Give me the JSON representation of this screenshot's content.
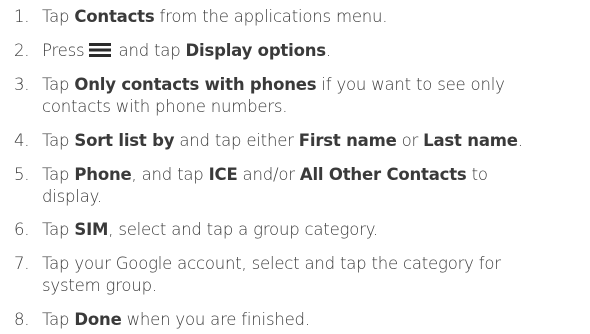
{
  "steps": [
    {
      "number": "1.",
      "parts": [
        {
          "t": "Tap "
        },
        {
          "t": "Contacts",
          "b": true
        },
        {
          "t": " from the applications menu."
        }
      ]
    },
    {
      "number": "2.",
      "parts": [
        {
          "t": "Press "
        },
        {
          "icon": "menu-icon"
        },
        {
          "t": " and tap "
        },
        {
          "t": "Display options",
          "b": true
        },
        {
          "t": "."
        }
      ]
    },
    {
      "number": "3.",
      "parts": [
        {
          "t": "Tap "
        },
        {
          "t": "Only contacts with phones",
          "b": true
        },
        {
          "t": " if you want to see only"
        },
        {
          "br": true
        },
        {
          "t": "contacts with phone numbers."
        }
      ]
    },
    {
      "number": "4.",
      "parts": [
        {
          "t": "Tap "
        },
        {
          "t": "Sort list by",
          "b": true
        },
        {
          "t": " and tap either "
        },
        {
          "t": "First name",
          "b": true
        },
        {
          "t": " or "
        },
        {
          "t": "Last name",
          "b": true
        },
        {
          "t": "."
        }
      ]
    },
    {
      "number": "5.",
      "parts": [
        {
          "t": "Tap "
        },
        {
          "t": "Phone",
          "b": true
        },
        {
          "t": ", and tap "
        },
        {
          "t": "ICE",
          "b": true
        },
        {
          "t": " and/or "
        },
        {
          "t": "All Other Contacts",
          "b": true
        },
        {
          "t": " to"
        },
        {
          "br": true
        },
        {
          "t": "display."
        }
      ]
    },
    {
      "number": "6.",
      "parts": [
        {
          "t": "Tap "
        },
        {
          "t": "SIM",
          "b": true
        },
        {
          "t": ", select and tap a group category."
        }
      ]
    },
    {
      "number": "7.",
      "parts": [
        {
          "t": "Tap your Google account, select and tap the category for"
        },
        {
          "br": true
        },
        {
          "t": "system group."
        }
      ]
    },
    {
      "number": "8.",
      "parts": [
        {
          "t": "Tap "
        },
        {
          "t": "Done",
          "b": true
        },
        {
          "t": " when you are finished."
        }
      ]
    }
  ]
}
